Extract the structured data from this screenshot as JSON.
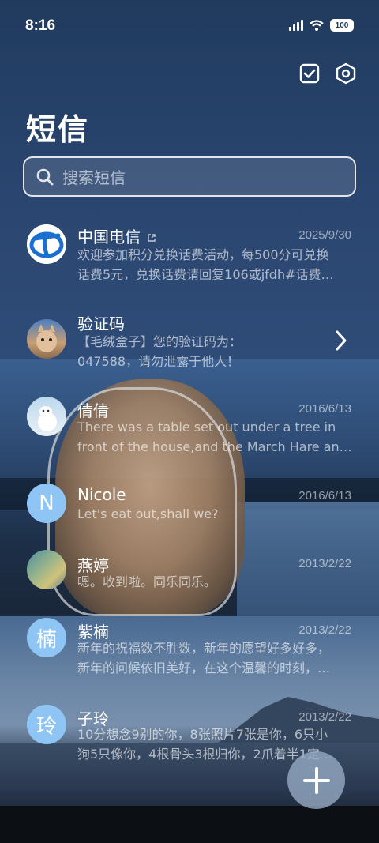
{
  "status_bar": {
    "time": "8:16",
    "battery": "100"
  },
  "header": {
    "title": "短信"
  },
  "search": {
    "placeholder": "搜索短信"
  },
  "conversations": [
    {
      "name": "中国电信",
      "date": "2025/9/30",
      "preview1": "欢迎参加积分兑换话费活动，每500分可兑换",
      "preview2": "话费5元，兑换话费请回复106或jfdh#话费…",
      "avatar": "telecom-logo"
    },
    {
      "name": "验证码",
      "date": "",
      "preview1": "【毛绒盒子】您的验证码为：",
      "preview2": "047588，请勿泄露于他人！",
      "avatar": "cat-photo"
    },
    {
      "name": "倩倩",
      "date": "2016/6/13",
      "preview1": "There was a table set out under a tree in",
      "preview2": "front of the house,and the March Hare an…",
      "avatar": "polar-bear-photo"
    },
    {
      "name": "Nicole",
      "date": "2016/6/13",
      "preview1": "Let's eat out,shall we?",
      "preview2": "",
      "avatar_letter": "N"
    },
    {
      "name": "燕婷",
      "date": "2013/2/22",
      "preview1": "嗯。收到啦。同乐同乐。",
      "preview2": "",
      "avatar": "landscape-photo"
    },
    {
      "name": "紫楠",
      "date": "2013/2/22",
      "preview1": "新年的祝福数不胜数，新年的愿望好多好多，",
      "preview2": "新年的问候依旧美好，在这个温馨的时刻，…",
      "avatar_letter": "楠"
    },
    {
      "name": "子玲",
      "date": "2013/2/22",
      "preview1": "10分想念9别的你，8张照片7张是你，6只小",
      "preview2": "狗5只像你，4根骨头3根归你，2爪着半1定…",
      "avatar_letter": "玲"
    }
  ],
  "colors": {
    "accent_avatar": "#8ec5f5",
    "telecom_blue": "#1a6fd0"
  }
}
